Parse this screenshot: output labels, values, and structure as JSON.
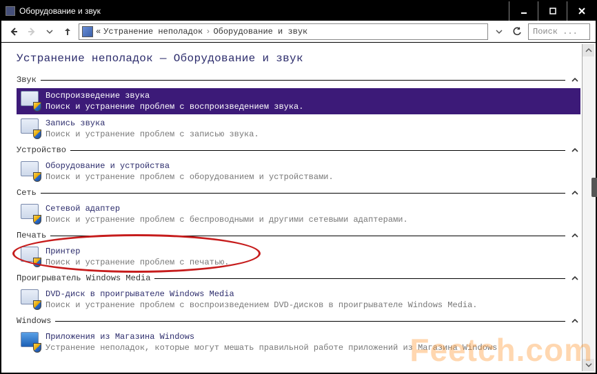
{
  "window": {
    "title": "Оборудование и звук"
  },
  "nav": {
    "breadcrumb_prefix": "«",
    "crumb1": "Устранение неполадок",
    "crumb2": "Оборудование и звук",
    "search_placeholder": "Поиск ..."
  },
  "page": {
    "title": "Устранение неполадок — Оборудование и звук"
  },
  "groups": [
    {
      "label": "Звук",
      "items": [
        {
          "title": "Воспроизведение звука",
          "desc": "Поиск и устранение проблем с воспроизведением звука.",
          "selected": true
        },
        {
          "title": "Запись звука",
          "desc": "Поиск и устранение проблем с записью звука."
        }
      ]
    },
    {
      "label": "Устройство",
      "items": [
        {
          "title": "Оборудование и устройства",
          "desc": "Поиск и устранение проблем с оборудованием и устройствами."
        }
      ]
    },
    {
      "label": "Сеть",
      "items": [
        {
          "title": "Сетевой адаптер",
          "desc": "Поиск и устранение проблем с беспроводными и другими сетевыми адаптерами."
        }
      ]
    },
    {
      "label": "Печать",
      "items": [
        {
          "title": "Принтер",
          "desc": "Поиск и устранение проблем с печатью."
        }
      ]
    },
    {
      "label": "Проигрыватель Windows Media",
      "items": [
        {
          "title": "DVD-диск в проигрывателе Windows Media",
          "desc": "Поиск и устранение проблем с воспроизведением DVD-дисков в проигрывателе Windows Media."
        }
      ]
    },
    {
      "label": "Windows",
      "items": [
        {
          "title": "Приложения из Магазина Windows",
          "desc": "Устранение неполадок, которые могут мешать правильной работе приложений из Магазина Windows"
        }
      ]
    }
  ],
  "watermark": "Feetch.com"
}
